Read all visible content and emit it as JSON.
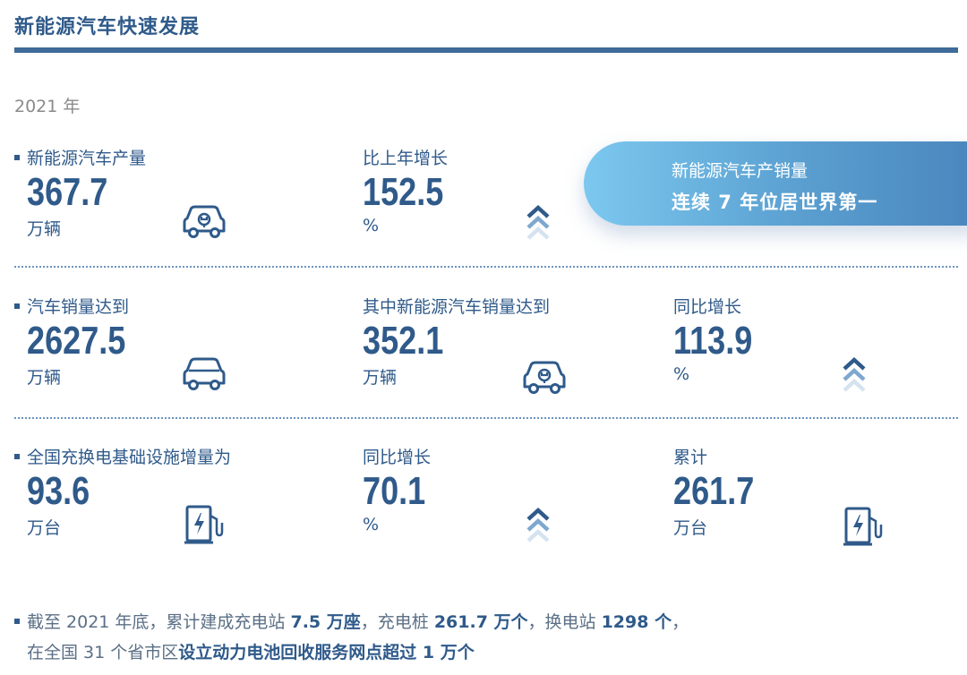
{
  "title": "新能源汽车快速发展",
  "year": "2021 年",
  "banner": {
    "line1": "新能源汽车产销量",
    "line2": "连续 7 年位居世界第一"
  },
  "rows": [
    [
      {
        "label": "新能源汽车产量",
        "value": "367.7",
        "unit": "万辆",
        "icon": "electric-car-icon"
      },
      {
        "label": "比上年增长",
        "value": "152.5",
        "unit": "%",
        "icon": "up-chevrons-icon"
      }
    ],
    [
      {
        "label": "汽车销量达到",
        "value": "2627.5",
        "unit": "万辆",
        "icon": "car-icon"
      },
      {
        "label": "其中新能源汽车销量达到",
        "value": "352.1",
        "unit": "万辆",
        "icon": "electric-car-icon"
      },
      {
        "label": "同比增长",
        "value": "113.9",
        "unit": "%",
        "icon": "up-chevrons-icon"
      }
    ],
    [
      {
        "label": "全国充换电基础设施增量为",
        "value": "93.6",
        "unit": "万台",
        "icon": "charging-station-icon"
      },
      {
        "label": "同比增长",
        "value": "70.1",
        "unit": "%",
        "icon": "up-chevrons-icon"
      },
      {
        "label": "累计",
        "value": "261.7",
        "unit": "万台",
        "icon": "charging-station-icon"
      }
    ]
  ],
  "footer": {
    "line1": {
      "t1": "截至 2021 年底，累计建成充电站 ",
      "b1": "7.5 万座",
      "t2": "，充电桩 ",
      "b2": "261.7 万个",
      "t3": "，换电站 ",
      "b3": "1298 个",
      "t4": "，"
    },
    "line2": {
      "t1": "在全国 31 个省市区",
      "b1": "设立动力电池回收服务网点超过 1 万个"
    }
  },
  "colors": {
    "primary": "#2f5a8a",
    "divider": "#6b94be",
    "banner_start": "#7cc8ef",
    "banner_end": "#4a86bd",
    "muted": "#8a8a8a"
  }
}
